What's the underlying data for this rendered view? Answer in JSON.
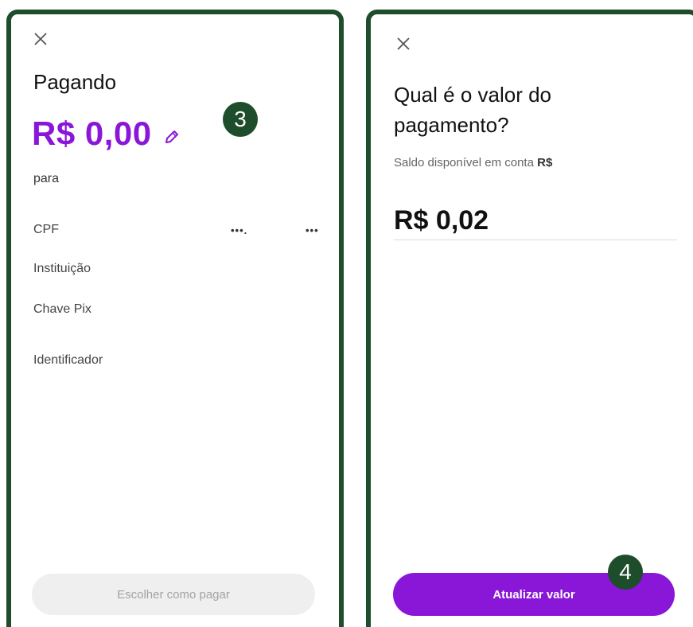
{
  "left_screen": {
    "close_icon": "close-icon",
    "title": "Pagando",
    "amount": "R$ 0,00",
    "edit_icon": "pencil-icon",
    "badge": "3",
    "para_label": "para",
    "fields": [
      {
        "label": "CPF",
        "value_mid": "•••.",
        "value_end": "•••"
      },
      {
        "label": "Instituição"
      },
      {
        "label": "Chave Pix"
      },
      {
        "label": "Identificador"
      }
    ],
    "choose_button": "Escolher como pagar"
  },
  "right_screen": {
    "close_icon": "close-icon",
    "question": "Qual é o valor do pagamento?",
    "saldo_text": "Saldo disponível em conta",
    "saldo_currency": "R$",
    "value": "R$ 0,02",
    "badge": "4",
    "update_button": "Atualizar valor"
  },
  "colors": {
    "accent": "#8a16d8",
    "frame": "#1e4d2b",
    "disabled_button": "#efefef"
  }
}
